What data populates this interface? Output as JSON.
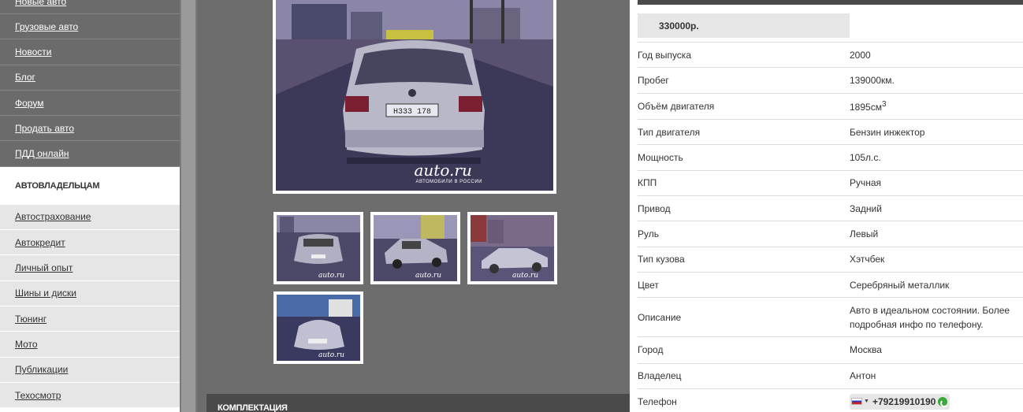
{
  "sidebar": {
    "top_items": [
      {
        "label": "Новые авто"
      },
      {
        "label": "Грузовые авто"
      },
      {
        "label": "Новости"
      },
      {
        "label": "Блог"
      },
      {
        "label": "Форум"
      },
      {
        "label": "Продать авто"
      },
      {
        "label": "ПДД онлайн"
      }
    ],
    "section_title": "АВТОВЛАДЕЛЬЦАМ",
    "bottom_items": [
      {
        "label": "Автострахование"
      },
      {
        "label": "Автокредит"
      },
      {
        "label": "Личный опыт"
      },
      {
        "label": "Шины и диски"
      },
      {
        "label": "Тюнинг"
      },
      {
        "label": "Мото"
      },
      {
        "label": "Публикации"
      },
      {
        "label": "Техосмотр"
      }
    ]
  },
  "gallery": {
    "watermark": "auto.ru",
    "watermark_sub": "АВТОМОБИЛИ В РОССИИ",
    "section_title": "КОМПЛЕКТАЦИЯ"
  },
  "listing": {
    "price": "330000р.",
    "specs": [
      {
        "label": "Год выпуска",
        "value": "2000"
      },
      {
        "label": "Пробег",
        "value": "139000км."
      },
      {
        "label": "Объём двигателя",
        "value": "1895см",
        "sup": "3"
      },
      {
        "label": "Тип двигателя",
        "value": "Бензин инжектор"
      },
      {
        "label": "Мощность",
        "value": "105л.с."
      },
      {
        "label": "КПП",
        "value": "Ручная"
      },
      {
        "label": "Привод",
        "value": "Задний"
      },
      {
        "label": "Руль",
        "value": "Левый"
      },
      {
        "label": "Тип кузова",
        "value": "Хэтчбек"
      },
      {
        "label": "Цвет",
        "value": "Серебряный металлик"
      },
      {
        "label": "Описание",
        "value": "Авто в идеальном состоянии. Более подробная инфо по телефону."
      },
      {
        "label": "Город",
        "value": "Москва"
      },
      {
        "label": "Владелец",
        "value": "Антон"
      }
    ],
    "phone_label": "Телефон",
    "phone": "+79219910190"
  }
}
